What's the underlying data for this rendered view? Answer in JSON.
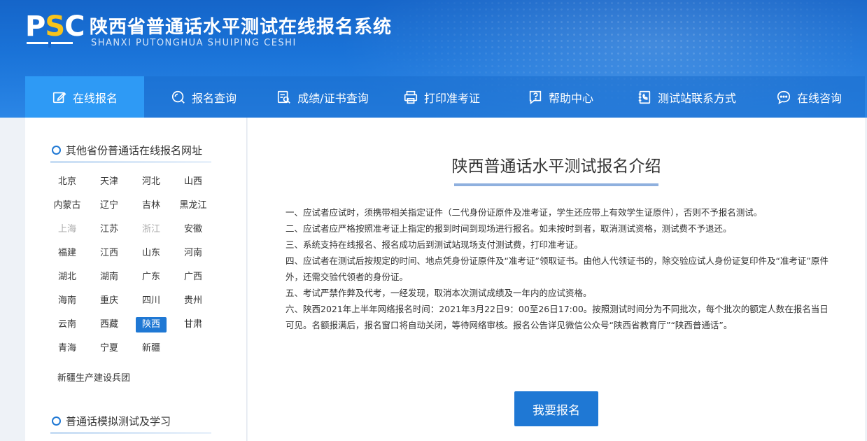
{
  "header": {
    "logo": {
      "p": "P",
      "s": "S",
      "c": "C"
    },
    "title": "陕西省普通话水平测试在线报名系统",
    "subtitle": "SHANXI PUTONGHUA SHUIPING CESHI"
  },
  "nav": [
    {
      "label": "在线报名",
      "icon": "edit-icon",
      "active": true
    },
    {
      "label": "报名查询",
      "icon": "search-circle-icon"
    },
    {
      "label": "成绩/证书查询",
      "icon": "document-search-icon"
    },
    {
      "label": "打印准考证",
      "icon": "printer-icon"
    },
    {
      "label": "帮助中心",
      "icon": "help-icon"
    },
    {
      "label": "测试站联系方式",
      "icon": "contact-book-icon"
    },
    {
      "label": "在线咨询",
      "icon": "chat-icon"
    }
  ],
  "sidebar": {
    "section1_title": "其他省份普通话在线报名网址",
    "provinces": [
      "北京",
      "天津",
      "河北",
      "山西",
      "内蒙古",
      "辽宁",
      "吉林",
      "黑龙江",
      "上海",
      "江苏",
      "浙江",
      "安徽",
      "福建",
      "江西",
      "山东",
      "河南",
      "湖北",
      "湖南",
      "广东",
      "广西",
      "海南",
      "重庆",
      "四川",
      "贵州",
      "云南",
      "西藏",
      "陕西",
      "甘肃",
      "青海",
      "宁夏",
      "新疆"
    ],
    "gray_provinces": [
      "上海",
      "浙江"
    ],
    "active_province": "陕西",
    "extra": "新疆生产建设兵团",
    "section2_title": "普通话模拟测试及学习"
  },
  "main": {
    "title": "陕西普通话水平测试报名介绍",
    "items": [
      "一、应试者应试时，须携带相关指定证件（二代身份证原件及准考证，学生还应带上有效学生证原件），否则不予报名测试。",
      "二、应试者应严格按照准考证上指定的报到时间到现场进行报名。如未按时到者，取消测试资格，测试费不予退还。",
      "三、系统支持在线报名、报名成功后到测试站现场支付测试费，打印准考证。",
      "四、应试者在测试后按规定的时间、地点凭身份证原件及“准考证”领取证书。由他人代领证书的，除交验应试人身份证复印件及“准考证”原件外，还需交验代领者的身份证。",
      "五、考试严禁作弊及代考，一经发现，取消本次测试成绩及一年内的应试资格。",
      "六、陕西2021年上半年网络报名时间：2021年3月22日9：00至26日17:00。按照测试时间分为不同批次，每个批次的额定人数在报名当日可见。名额报满后，报名窗口将自动关闭，等待网络审核。报名公告详见微信公众号“陕西省教育厅”“陕西普通话”。"
    ],
    "apply_button": "我要报名"
  }
}
